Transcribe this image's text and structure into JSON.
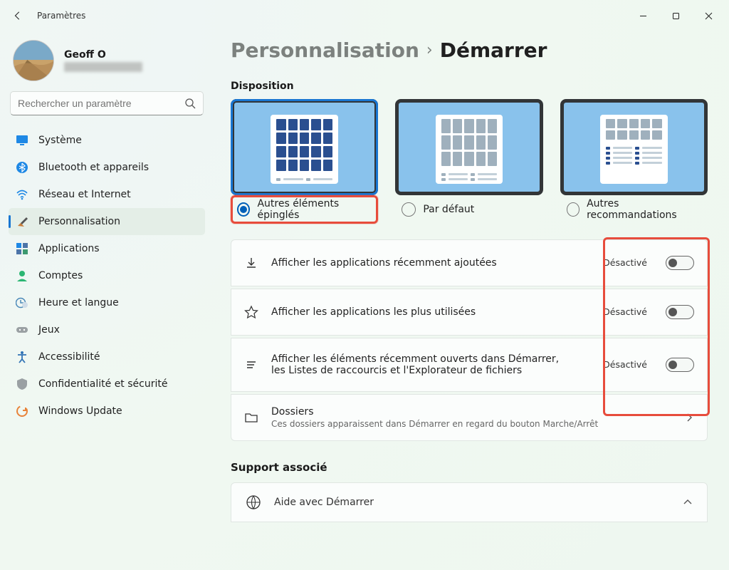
{
  "window": {
    "title": "Paramètres"
  },
  "profile": {
    "name": "Geoff O"
  },
  "search": {
    "placeholder": "Rechercher un paramètre"
  },
  "sidebar": {
    "items": [
      {
        "label": "Système"
      },
      {
        "label": "Bluetooth et appareils"
      },
      {
        "label": "Réseau et Internet"
      },
      {
        "label": "Personnalisation"
      },
      {
        "label": "Applications"
      },
      {
        "label": "Comptes"
      },
      {
        "label": "Heure et langue"
      },
      {
        "label": "Jeux"
      },
      {
        "label": "Accessibilité"
      },
      {
        "label": "Confidentialité et sécurité"
      },
      {
        "label": "Windows Update"
      }
    ],
    "selected_index": 3
  },
  "breadcrumb": {
    "parent": "Personnalisation",
    "sep": "›",
    "current": "Démarrer"
  },
  "sections": {
    "layout_label": "Disposition",
    "layout_options": [
      {
        "label": "Autres éléments épinglés",
        "selected": true
      },
      {
        "label": "Par défaut",
        "selected": false
      },
      {
        "label": "Autres recommandations",
        "selected": false
      }
    ]
  },
  "settings": [
    {
      "label": "Afficher les applications récemment ajoutées",
      "state": "Désactivé"
    },
    {
      "label": "Afficher les applications les plus utilisées",
      "state": "Désactivé"
    },
    {
      "label": "Afficher les éléments récemment ouverts dans Démarrer, les Listes de raccourcis et l'Explorateur de fichiers",
      "state": "Désactivé"
    },
    {
      "label": "Dossiers",
      "desc": "Ces dossiers apparaissent dans Démarrer en regard du bouton Marche/Arrêt"
    }
  ],
  "support": {
    "heading": "Support associé",
    "item": "Aide avec Démarrer"
  }
}
